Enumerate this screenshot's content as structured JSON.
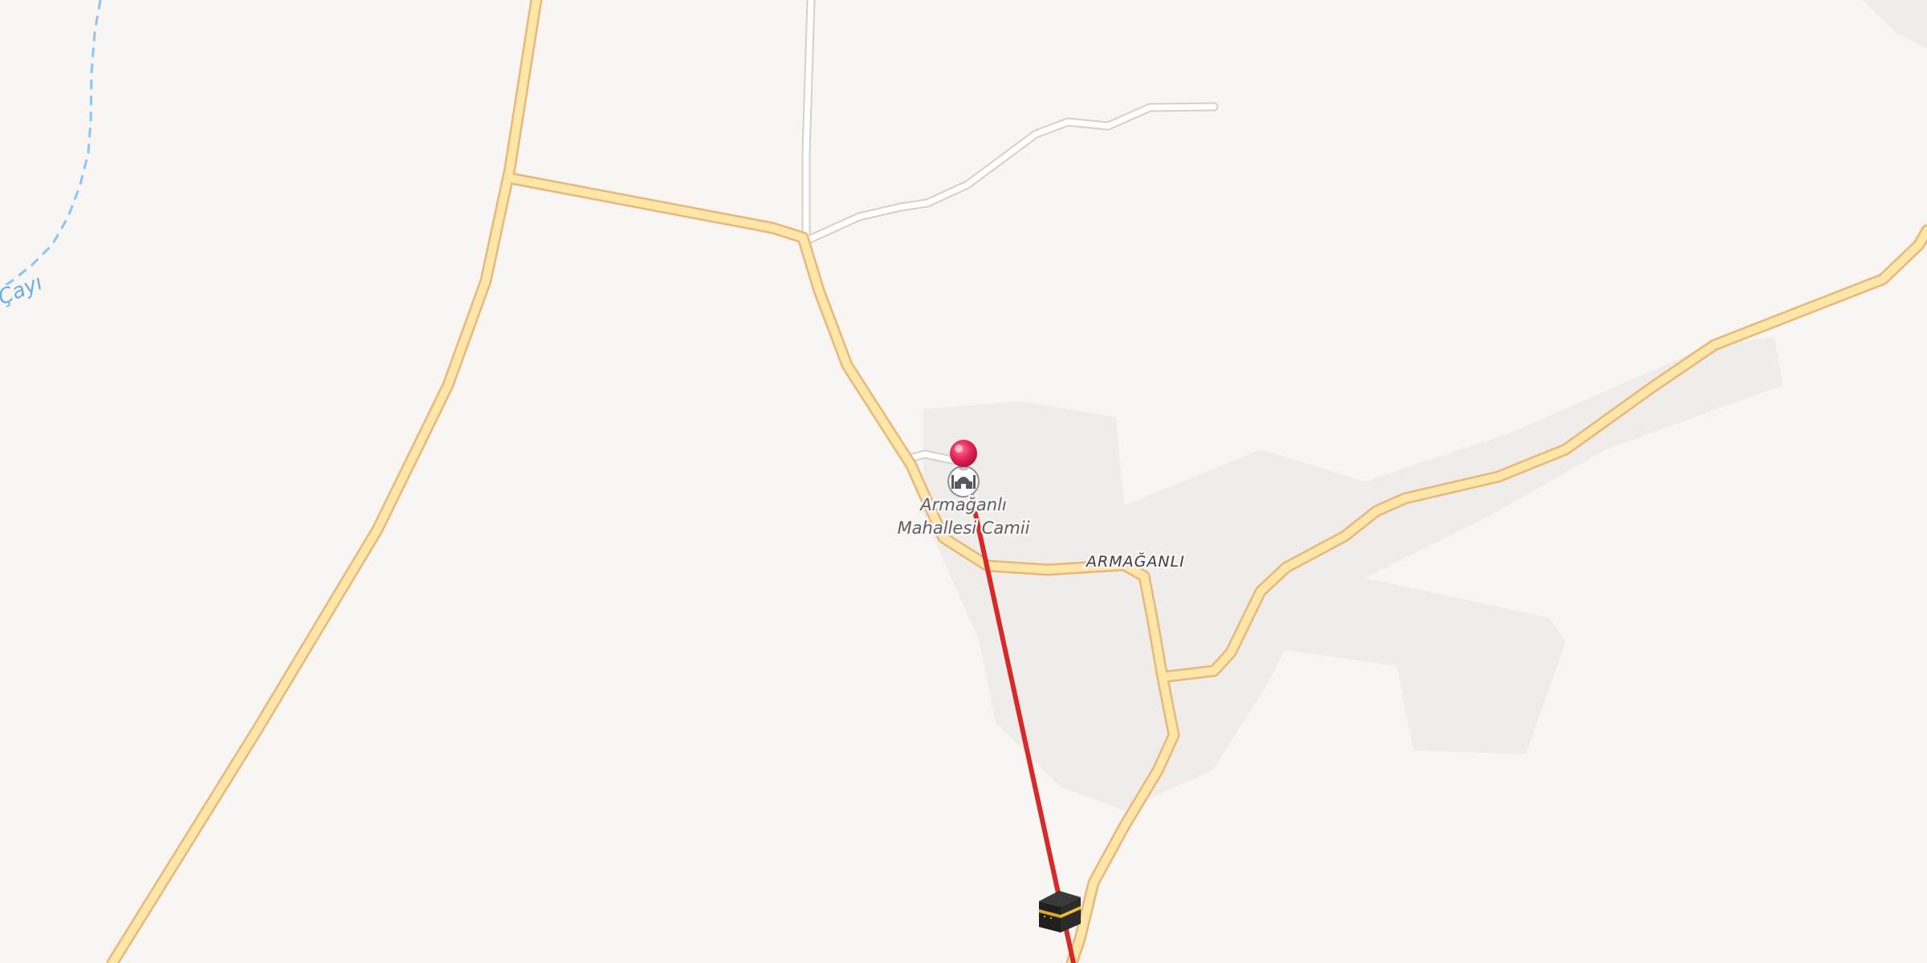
{
  "map": {
    "colors": {
      "background": "#f8f5f2",
      "landuse": "#f0ecea",
      "road_fill": "#fde6a8",
      "road_casing": "#e8b77a",
      "track_fill": "#ffffff",
      "track_casing": "#d4d0cc",
      "stream": "#8cc4f2",
      "route_line": "#d62a2a",
      "pin": "#e8265a"
    },
    "labels": {
      "poi_line1": "Armağanlı",
      "poi_line2": "Mahallesi Camii",
      "locality": "ARMAĞANLI",
      "stream": "Çayı"
    },
    "markers": {
      "pin": "location-pin-icon",
      "poi": "mosque-icon",
      "destination": "kaaba-icon"
    }
  }
}
